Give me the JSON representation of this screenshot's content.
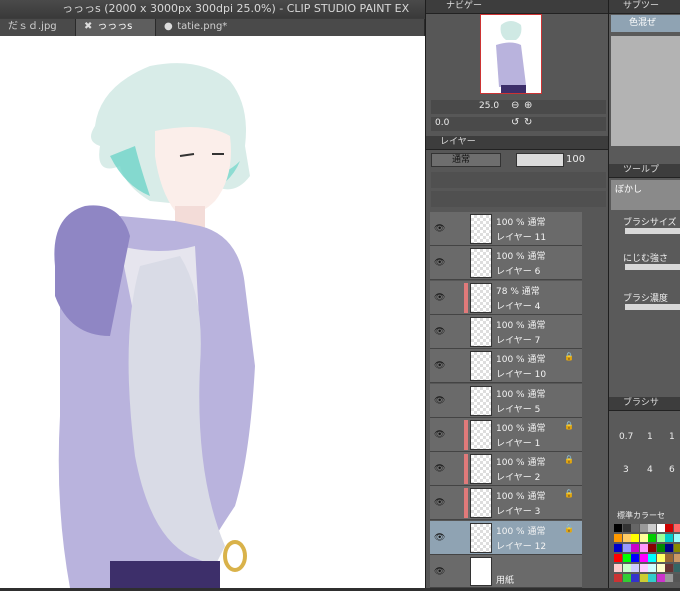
{
  "window": {
    "title": "っっっs (2000 x 3000px 300dpi 25.0%)  - CLIP STUDIO PAINT EX"
  },
  "tabs": [
    {
      "label": "だｓｄ.jpg",
      "active": false
    },
    {
      "label": "っっっs",
      "active": true
    },
    {
      "label": "tatie.png*",
      "active": false
    }
  ],
  "navigator": {
    "tab_label": "ナビゲー",
    "zoom_value": "25.0",
    "rotation_value": "0.0"
  },
  "layer_panel": {
    "tab_label": "レイヤー",
    "blend_mode": "通常",
    "opacity": "100",
    "layers": [
      {
        "opacity_mode": "100 % 通常",
        "name": "レイヤー 11",
        "color_mark": false,
        "locked": false,
        "selected": false
      },
      {
        "opacity_mode": "100 % 通常",
        "name": "レイヤー 6",
        "color_mark": false,
        "locked": false,
        "selected": false
      },
      {
        "opacity_mode": "78 % 通常",
        "name": "レイヤー 4",
        "color_mark": true,
        "locked": false,
        "selected": false
      },
      {
        "opacity_mode": "100 % 通常",
        "name": "レイヤー 7",
        "color_mark": false,
        "locked": false,
        "selected": false
      },
      {
        "opacity_mode": "100 % 通常",
        "name": "レイヤー 10",
        "color_mark": false,
        "locked": true,
        "selected": false
      },
      {
        "opacity_mode": "100 % 通常",
        "name": "レイヤー 5",
        "color_mark": false,
        "locked": false,
        "selected": false
      },
      {
        "opacity_mode": "100 % 通常",
        "name": "レイヤー 1",
        "color_mark": true,
        "locked": true,
        "selected": false
      },
      {
        "opacity_mode": "100 % 通常",
        "name": "レイヤー 2",
        "color_mark": true,
        "locked": true,
        "selected": false
      },
      {
        "opacity_mode": "100 % 通常",
        "name": "レイヤー 3",
        "color_mark": true,
        "locked": true,
        "selected": false
      },
      {
        "opacity_mode": "100 % 通常",
        "name": "レイヤー 12",
        "color_mark": false,
        "locked": true,
        "selected": true
      }
    ],
    "paper_label": "用紙"
  },
  "subtool": {
    "tab_label": "サブツー",
    "current": "色混ぜ"
  },
  "tool_property": {
    "tab_label": "ツールプ",
    "tool_name": "ぼかし",
    "props": [
      "ブラシサイズ",
      "にじむ強さ",
      "ブラシ濃度"
    ]
  },
  "brush_size": {
    "tab_label": "ブラシサ",
    "sizes": [
      "0.7",
      "1",
      "1",
      "3",
      "4",
      "6"
    ]
  },
  "color_set": {
    "tab_label": "標準カラーセ"
  }
}
